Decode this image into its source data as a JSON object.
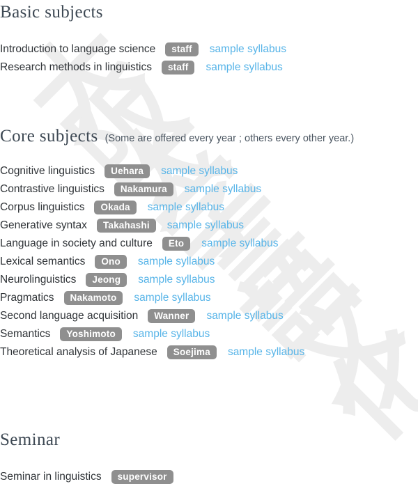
{
  "page": {
    "background_color": "#ffffff",
    "heading_color": "#3d4853",
    "body_text_color": "#2f3337",
    "badge_color": "#8f8f8f",
    "badge_text_color": "#ffffff",
    "link_color": "#57b4e8",
    "watermark_color": "#ededed"
  },
  "watermark": {
    "characters": [
      "大",
      "阪",
      "大",
      "学",
      "言",
      "語",
      "文",
      "化"
    ]
  },
  "sections": [
    {
      "id": "basic",
      "title": "Basic subjects",
      "note": "",
      "courses": [
        {
          "name": "Introduction to language science",
          "instructor": "staff",
          "link": "sample syllabus"
        },
        {
          "name": "Research methods in linguistics",
          "instructor": "staff",
          "link": "sample syllabus"
        }
      ]
    },
    {
      "id": "core",
      "title": "Core subjects",
      "note": "(Some are offered every year ; others every other year.)",
      "courses": [
        {
          "name": "Cognitive linguistics",
          "instructor": "Uehara",
          "link": "sample syllabus"
        },
        {
          "name": "Contrastive linguistics",
          "instructor": "Nakamura",
          "link": "sample syllabus"
        },
        {
          "name": "Corpus linguistics",
          "instructor": "Okada",
          "link": "sample syllabus"
        },
        {
          "name": "Generative syntax",
          "instructor": "Takahashi",
          "link": "sample syllabus"
        },
        {
          "name": "Language in society and culture",
          "instructor": "Eto",
          "link": "sample syllabus"
        },
        {
          "name": "Lexical semantics",
          "instructor": "Ono",
          "link": "sample syllabus"
        },
        {
          "name": "Neurolinguistics",
          "instructor": "Jeong",
          "link": "sample syllabus"
        },
        {
          "name": "Pragmatics",
          "instructor": "Nakamoto",
          "link": "sample syllabus"
        },
        {
          "name": "Second language acquisition",
          "instructor": "Wanner",
          "link": "sample syllabus"
        },
        {
          "name": "Semantics",
          "instructor": "Yoshimoto",
          "link": "sample syllabus"
        },
        {
          "name": "Theoretical analysis of Japanese",
          "instructor": "Soejima",
          "link": "sample syllabus"
        }
      ]
    },
    {
      "id": "seminar",
      "title": "Seminar",
      "note": "",
      "courses": [
        {
          "name": "Seminar in linguistics",
          "instructor": "supervisor",
          "link": ""
        }
      ]
    }
  ]
}
